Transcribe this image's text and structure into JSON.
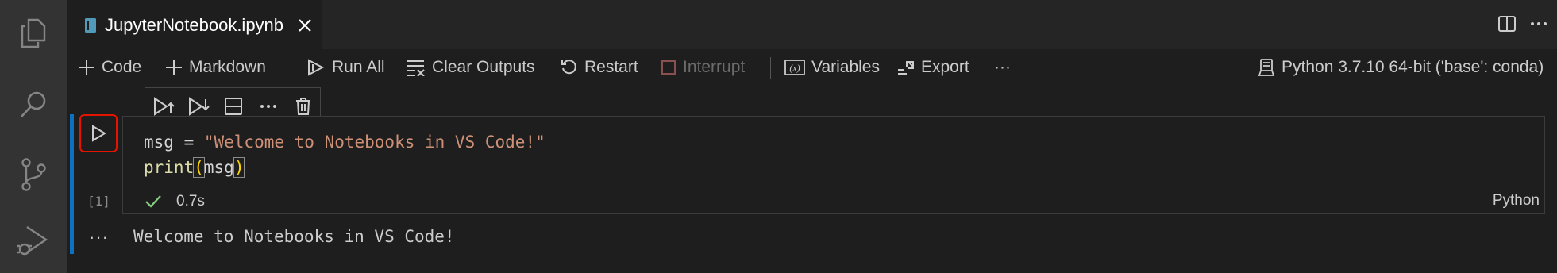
{
  "tab": {
    "title": "JupyterNotebook.ipynb"
  },
  "toolbar": {
    "code": "Code",
    "markdown": "Markdown",
    "run_all": "Run All",
    "clear_outputs": "Clear Outputs",
    "restart": "Restart",
    "interrupt": "Interrupt",
    "variables": "Variables",
    "export": "Export",
    "more": "···",
    "kernel": "Python 3.7.10 64-bit ('base': conda)"
  },
  "cell": {
    "execution_count": "[1]",
    "duration": "0.7s",
    "language": "Python",
    "code": {
      "line1_var": "msg = ",
      "line1_str": "\"Welcome to Notebooks in VS Code!\"",
      "line2_fn": "print",
      "line2_open": "(",
      "line2_arg": "msg",
      "line2_close": ")"
    },
    "output_more": "···",
    "output": "Welcome to Notebooks in VS Code!"
  },
  "colors": {
    "accent": "#0e70c0",
    "run_highlight": "#e51400",
    "string": "#ce9178",
    "function": "#dcdcaa",
    "success": "#89d185"
  }
}
